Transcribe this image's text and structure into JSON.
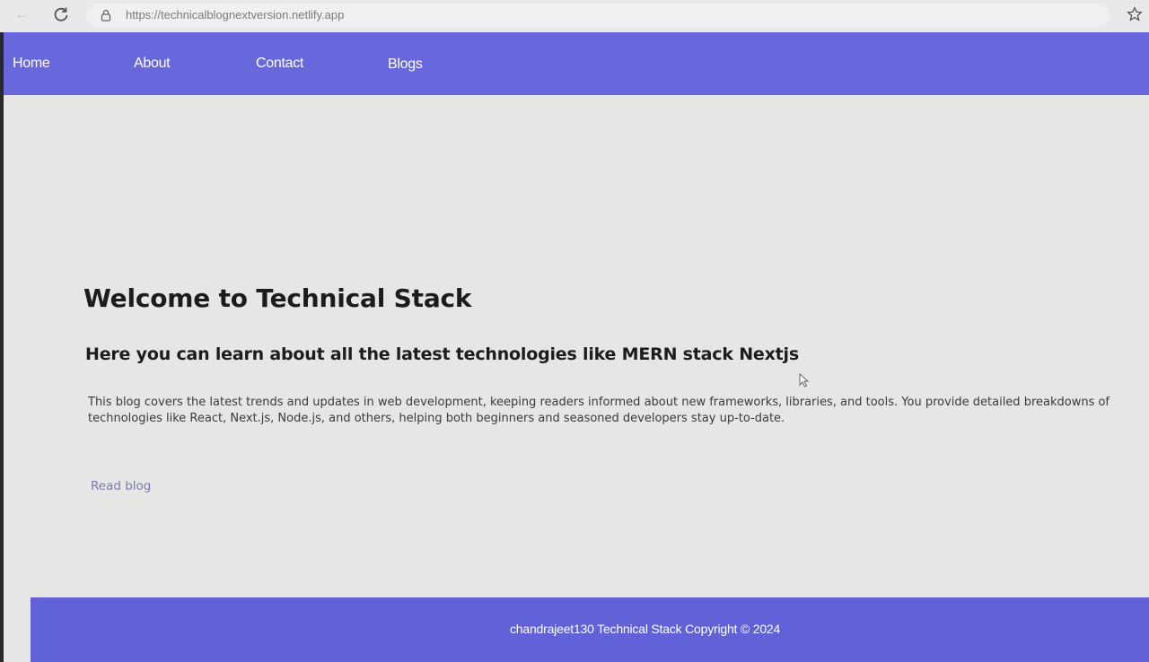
{
  "browser": {
    "url": "https://technicalblognextversion.netlify.app",
    "icons": [
      "back-icon",
      "reload-icon",
      "lock-icon",
      "star-icon"
    ]
  },
  "nav": {
    "items": [
      {
        "label": "Home"
      },
      {
        "label": "About"
      },
      {
        "label": "Contact"
      },
      {
        "label": "Blogs"
      }
    ]
  },
  "hero": {
    "title": "Welcome to Technical Stack",
    "subtitle": "Here you can learn about all the latest technologies like MERN stack Nextjs",
    "description": "This blog covers the latest trends and updates in web development, keeping readers informed about new frameworks, libraries, and tools. You provide detailed breakdowns of technologies like React, Next.js, Node.js, and others, helping both beginners and seasoned developers stay up-to-date.",
    "link_label": "Read blog"
  },
  "footer": {
    "text": "chandrajeet130 Technical Stack Copyright © 2024"
  },
  "colors": {
    "accent": "#6868dc",
    "page_bg": "#e6e6e4",
    "link": "#7a7ab8"
  }
}
